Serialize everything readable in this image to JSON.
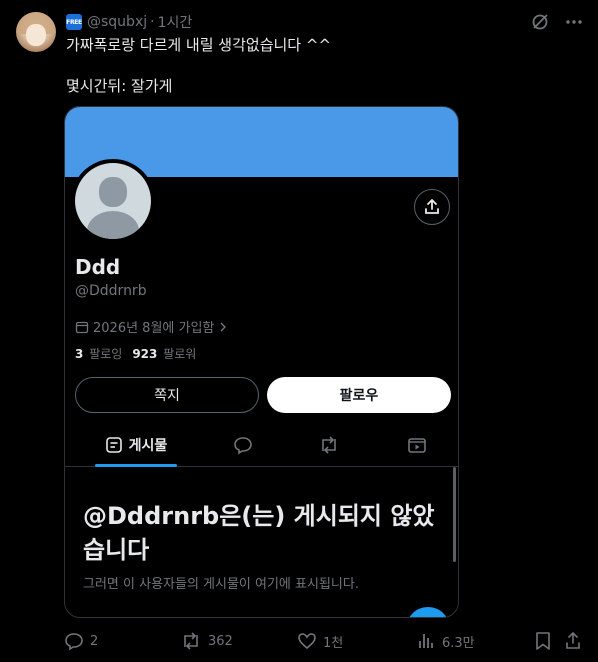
{
  "post": {
    "handle": "@squbxj",
    "separator": "·",
    "time": "1시간",
    "badge": "FREE",
    "text_line1": "가짜폭로랑 다르게 내릴 생각없습니다 ^^",
    "text_line2": "몇시간뒤: 잘가게"
  },
  "embedded_profile": {
    "display_name": "Ddd",
    "username": "@Dddrnrb",
    "joined": "2026년 8월에 가입함",
    "following_count": "3",
    "following_label": "팔로잉",
    "followers_count": "923",
    "followers_label": "팔로워",
    "message_button": "쪽지",
    "follow_button": "팔로우",
    "tab_posts": "게시물",
    "empty_title": "@Dddrnrb은(는) 게시되지 않았습니다",
    "empty_subtitle": "그러면 이 사용자들의 게시물이 여기에 표시됩니다."
  },
  "actions": {
    "replies": "2",
    "reposts": "362",
    "likes": "1천",
    "views": "6.3만"
  },
  "colors": {
    "background": "#000000",
    "banner": "#4a99e9",
    "accent": "#1d9bf0",
    "muted": "#71767b"
  }
}
